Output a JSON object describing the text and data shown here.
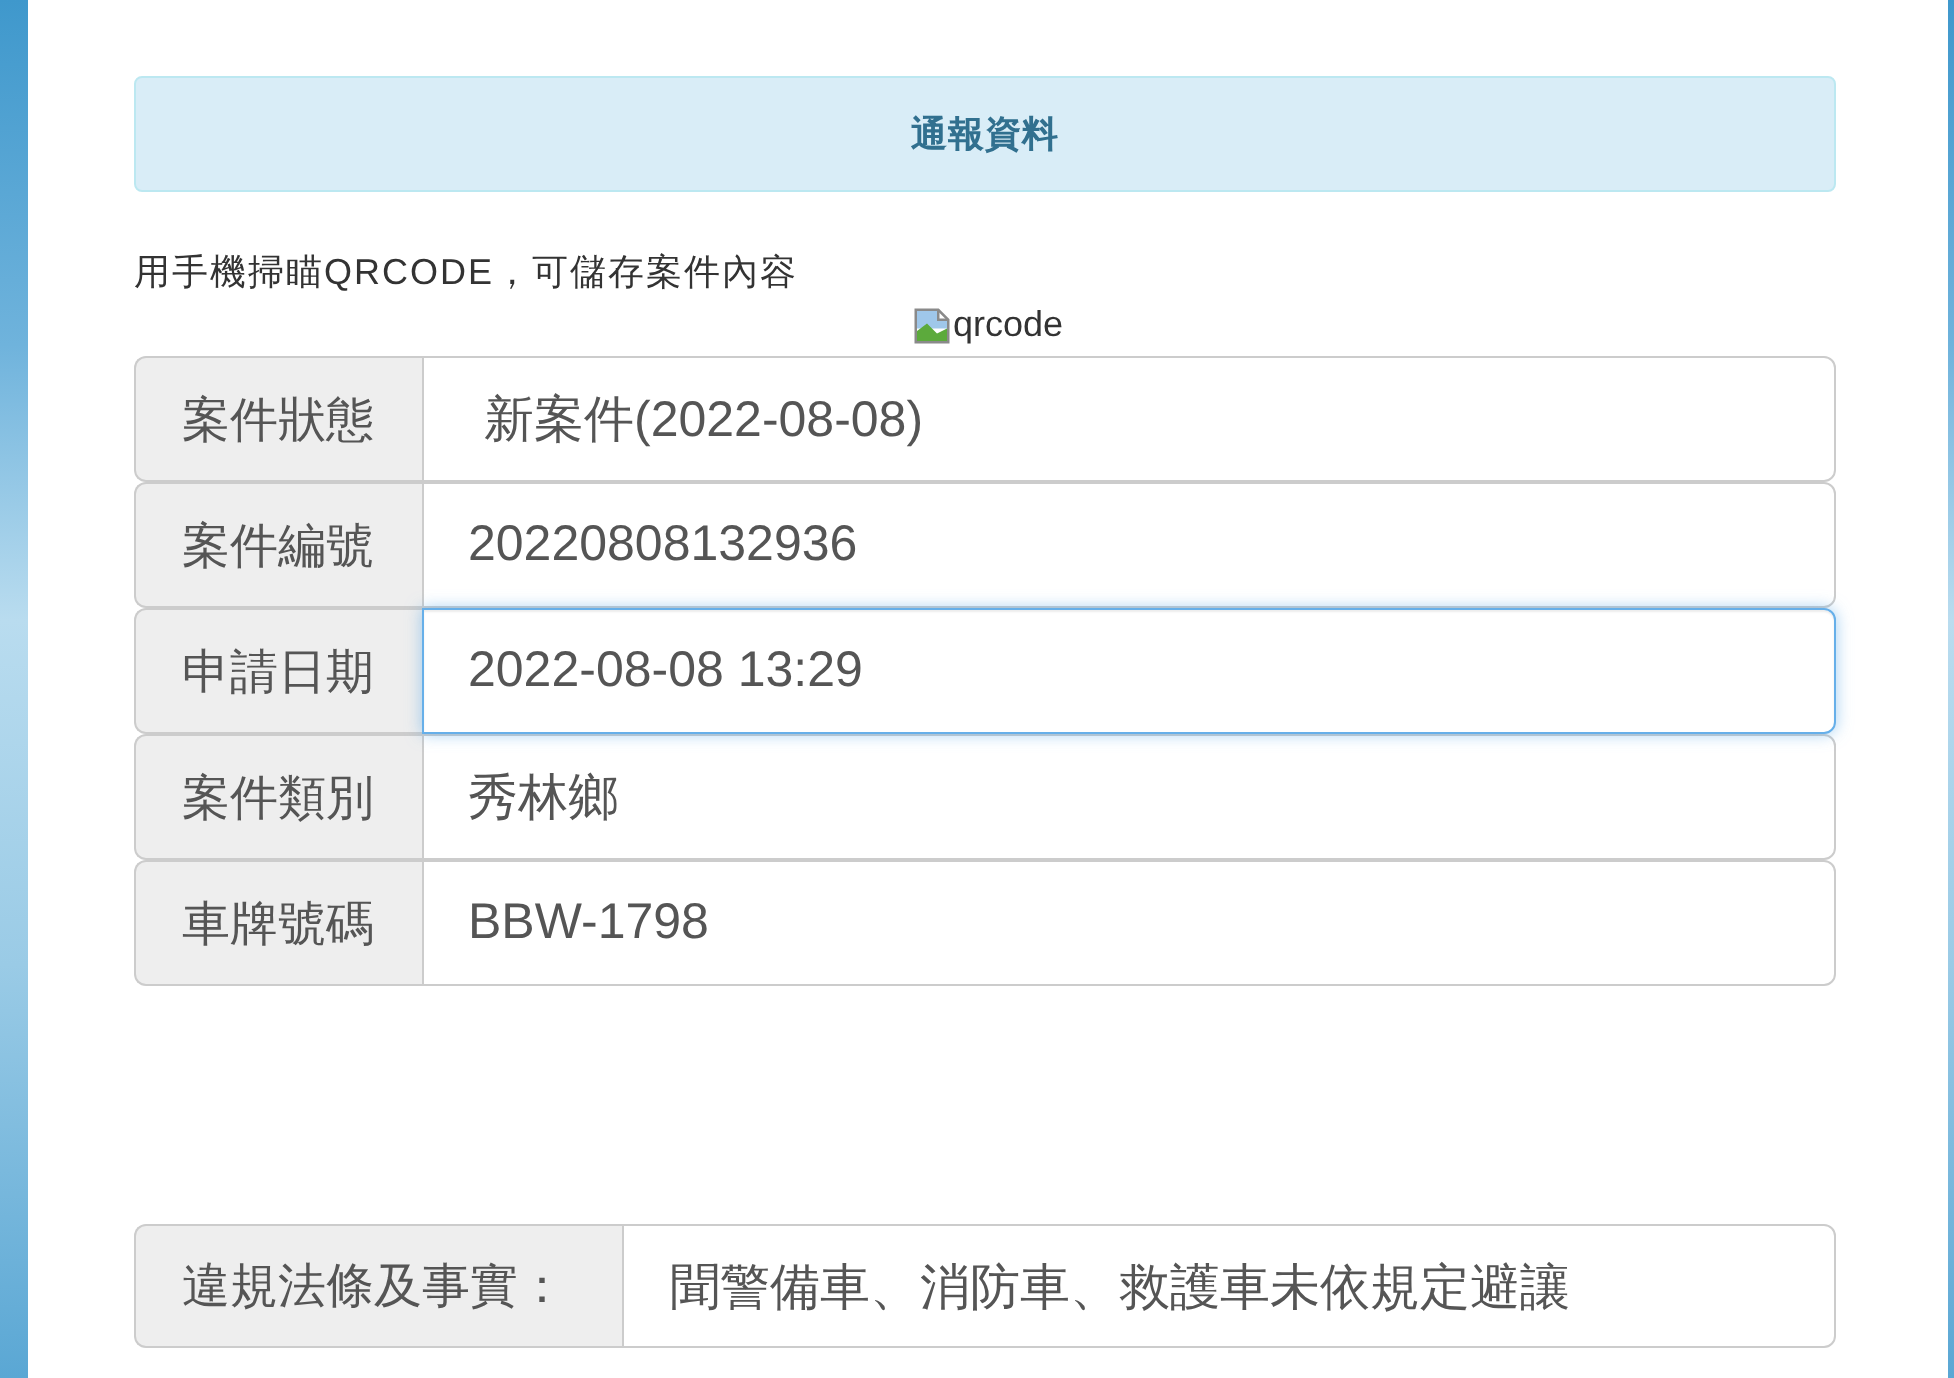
{
  "heading": "通報資料",
  "qr_hint": "用手機掃瞄QRCODE，可儲存案件內容",
  "qr_image": {
    "alt": "qrcode"
  },
  "fields": [
    {
      "label": "案件狀態",
      "value": "新案件(2022-08-08)",
      "kind": "static",
      "focused": false
    },
    {
      "label": "案件編號",
      "value": "20220808132936",
      "kind": "input",
      "focused": false
    },
    {
      "label": "申請日期",
      "value": "2022-08-08 13:29",
      "kind": "input",
      "focused": true
    },
    {
      "label": "案件類別",
      "value": "秀林鄉",
      "kind": "input",
      "focused": false
    },
    {
      "label": "車牌號碼",
      "value": "BBW-1798",
      "kind": "input",
      "focused": false
    }
  ],
  "violation": {
    "label": "違規法條及事實：",
    "value": "聞警備車、消防車、救護車未依規定避讓"
  }
}
